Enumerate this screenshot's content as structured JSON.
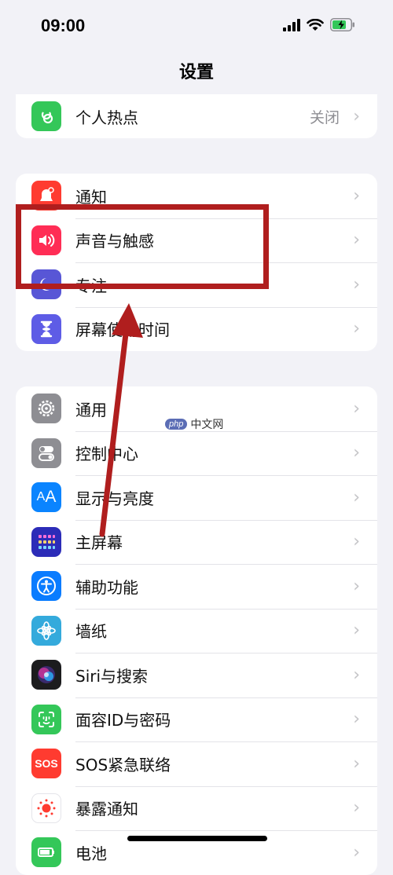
{
  "status": {
    "time": "09:00"
  },
  "nav": {
    "title": "设置"
  },
  "groups": [
    {
      "rows": [
        {
          "label": "个人热点",
          "value": "关闭",
          "icon": "hotspot-icon",
          "color": "#34c759"
        }
      ]
    },
    {
      "rows": [
        {
          "label": "通知",
          "icon": "notification-bell-icon",
          "color": "#ff3b30"
        },
        {
          "label": "声音与触感",
          "icon": "speaker-icon",
          "color": "#ff2d55"
        },
        {
          "label": "专注",
          "icon": "moon-icon",
          "color": "#5856d6"
        },
        {
          "label": "屏幕使用时间",
          "icon": "hourglass-icon",
          "color": "#5e5ce6"
        }
      ]
    },
    {
      "rows": [
        {
          "label": "通用",
          "icon": "gear-icon",
          "color": "#8e8e93"
        },
        {
          "label": "控制中心",
          "icon": "toggles-icon",
          "color": "#8e8e93"
        },
        {
          "label": "显示与亮度",
          "icon": "text-size-icon",
          "color": "#0a84ff"
        },
        {
          "label": "主屏幕",
          "icon": "home-grid-icon",
          "color": "#2c2cb8"
        },
        {
          "label": "辅助功能",
          "icon": "accessibility-icon",
          "color": "#0a7cff"
        },
        {
          "label": "墙纸",
          "icon": "flower-icon",
          "color": "#34aadc"
        },
        {
          "label": "Siri与搜索",
          "icon": "siri-icon",
          "color": "#1c1c1e"
        },
        {
          "label": "面容ID与密码",
          "icon": "face-id-icon",
          "color": "#34c759"
        },
        {
          "label": "SOS紧急联络",
          "icon": "sos-icon",
          "color": "#ff3b30"
        },
        {
          "label": "暴露通知",
          "icon": "exposure-icon",
          "color": "#ffffff"
        },
        {
          "label": "电池",
          "icon": "battery-icon",
          "color": "#34c759"
        }
      ]
    }
  ],
  "sos_text": "SOS",
  "watermark": {
    "logo": "php",
    "text": "中文网"
  }
}
